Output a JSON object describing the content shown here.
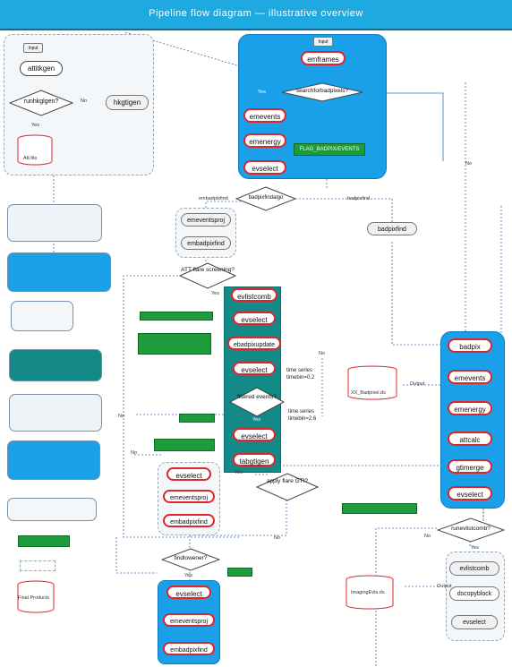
{
  "title": "Pipeline flow diagram — illustrative overview",
  "top_left": {
    "input": "Input",
    "attitude_tool": "attitkgen",
    "decision": "runhkglgen?",
    "no": "No",
    "hk_tool": "hkgtigen",
    "yes": "Yes",
    "product": "Att.fits"
  },
  "top_center": {
    "input": "Input",
    "emframes": "emframes",
    "decision": "searchforbadpixels?",
    "yes": "Yes",
    "emevents": "emevents",
    "emenergy": "emenergy",
    "evselect": "evselect",
    "green_note": "FLAG_BADPIX/EVENTS",
    "no": "No"
  },
  "badpix_decision": {
    "label": "badpixfindalgo",
    "left": "embadpixfind",
    "right": "badpixfind"
  },
  "gray_group": {
    "a": "emeventsproj",
    "b": "embadpixfind",
    "right": "badpixfind"
  },
  "att_decision": {
    "label": "ATT flare screening?",
    "yes": "Yes"
  },
  "teal_chain": {
    "evlistcomb": "evlistcomb",
    "evselect1": "evselect",
    "ebadpixupdate": "ebadpixupdate",
    "evselect2": "evselect",
    "filtered": "filtered events?",
    "yes": "Yes",
    "evselect3": "evselect",
    "tabgtigen": "tabgtigen",
    "timeseries1": "time series timebin=0.2",
    "timeseries2": "time series timebin=2.6"
  },
  "apply_flare": {
    "label": "apply flare GTI?",
    "yes": "Yes",
    "no": "No"
  },
  "left_group": {
    "a": "evselect",
    "b": "emeventsproj",
    "c": "embadpixfind"
  },
  "findlowener": {
    "label": "findlowener?",
    "yes": "Yes"
  },
  "bottom_group": {
    "a": "evselect",
    "b": "emeventsproj",
    "c": "embadpixfind"
  },
  "right_panel": {
    "a": "badpix",
    "b": "emevents",
    "c": "emenergy",
    "d": "attcalc",
    "e": "gtimerge",
    "f": "evselect",
    "output": "Output"
  },
  "runevlist": {
    "label": "runevlistcomb?",
    "yes": "Yes",
    "no": "No"
  },
  "bottom_right": {
    "a": "evlistcomb",
    "b": "dscopyblock",
    "c": "evselect",
    "output": "Output"
  },
  "products": {
    "badpix": "XX_Badpixel.ds",
    "imaging": "ImagingEvts.ds",
    "final": "Final Products"
  },
  "misc": {
    "no": "No"
  },
  "colors": {
    "banner": "#1ea9e0",
    "node_border": "#e0242b",
    "blue_panel": "#1aa0e8",
    "teal": "#148a88",
    "green": "#1e9b3a"
  }
}
